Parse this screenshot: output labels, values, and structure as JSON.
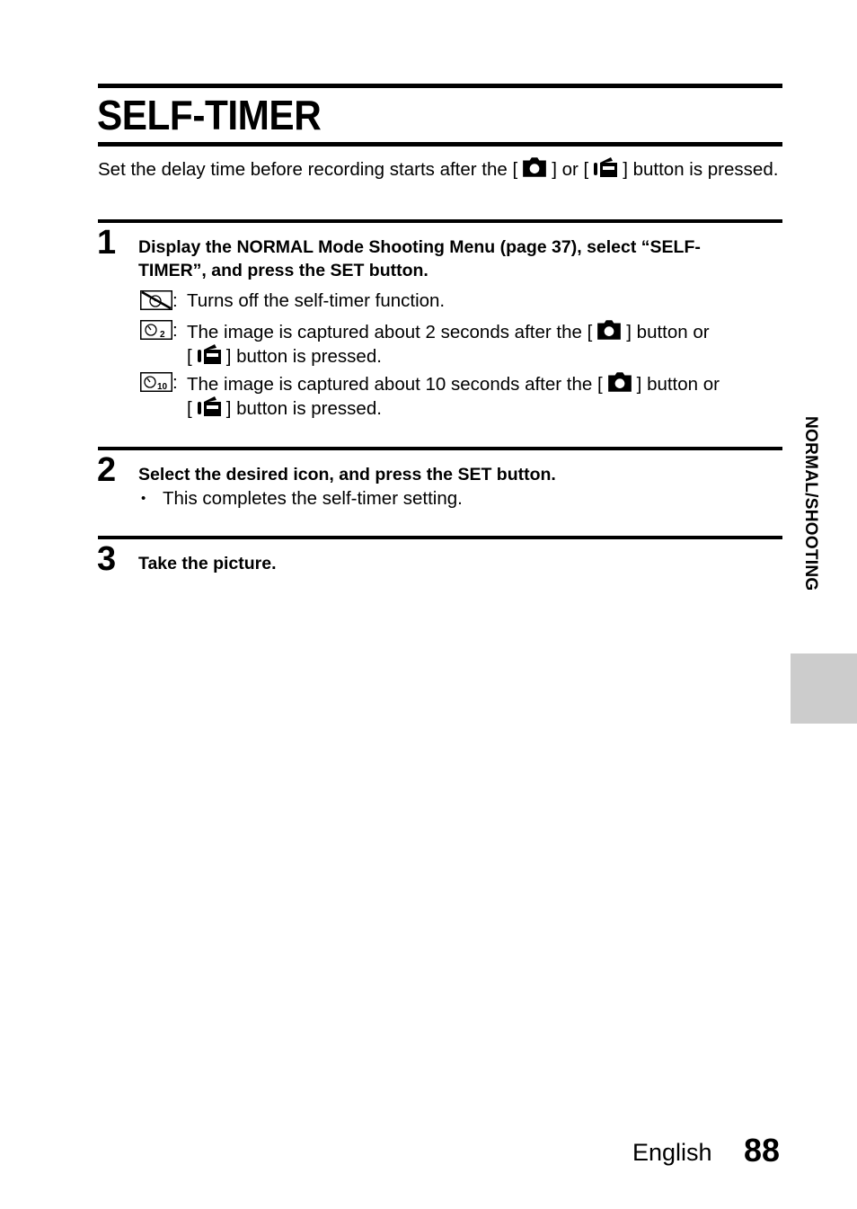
{
  "page": {
    "title": "SELF-TIMER",
    "intro": {
      "before_camera": "Set the delay time before recording starts after the [",
      "between": "] or [",
      "after_video": "] button is pressed."
    },
    "steps": [
      {
        "number": "1",
        "heading_line1": "Display the NORMAL Mode Shooting Menu (page 37), select “SELF-",
        "heading_line2": "TIMER”, and press the SET button.",
        "options": [
          {
            "icon": "self-timer-off-icon",
            "separator": ":",
            "text": "Turns off the self-timer function."
          },
          {
            "icon": "self-timer-2s-icon",
            "icon_subscript": "2",
            "separator": ":",
            "text_before_camera": "The image is captured about 2 seconds after the [",
            "text_between": "] button or",
            "text_line2_start": "[",
            "text_line2_end": "] button is pressed."
          },
          {
            "icon": "self-timer-10s-icon",
            "icon_subscript": "10",
            "separator": ":",
            "text_before_camera": "The image is captured about 10 seconds after the [",
            "text_between": "] button or",
            "text_line2_start": "[",
            "text_line2_end": "] button is pressed."
          }
        ]
      },
      {
        "number": "2",
        "heading": "Select the desired icon, and press the SET button.",
        "bullet_mark": "•",
        "bullet": "This completes the self-timer setting."
      },
      {
        "number": "3",
        "heading": "Take the picture."
      }
    ],
    "side_tab_label": "NORMAL/SHOOTING",
    "footer": {
      "language": "English",
      "page_number": "88"
    },
    "colors": {
      "text": "#000000",
      "side_tab": "#cccccc"
    }
  }
}
